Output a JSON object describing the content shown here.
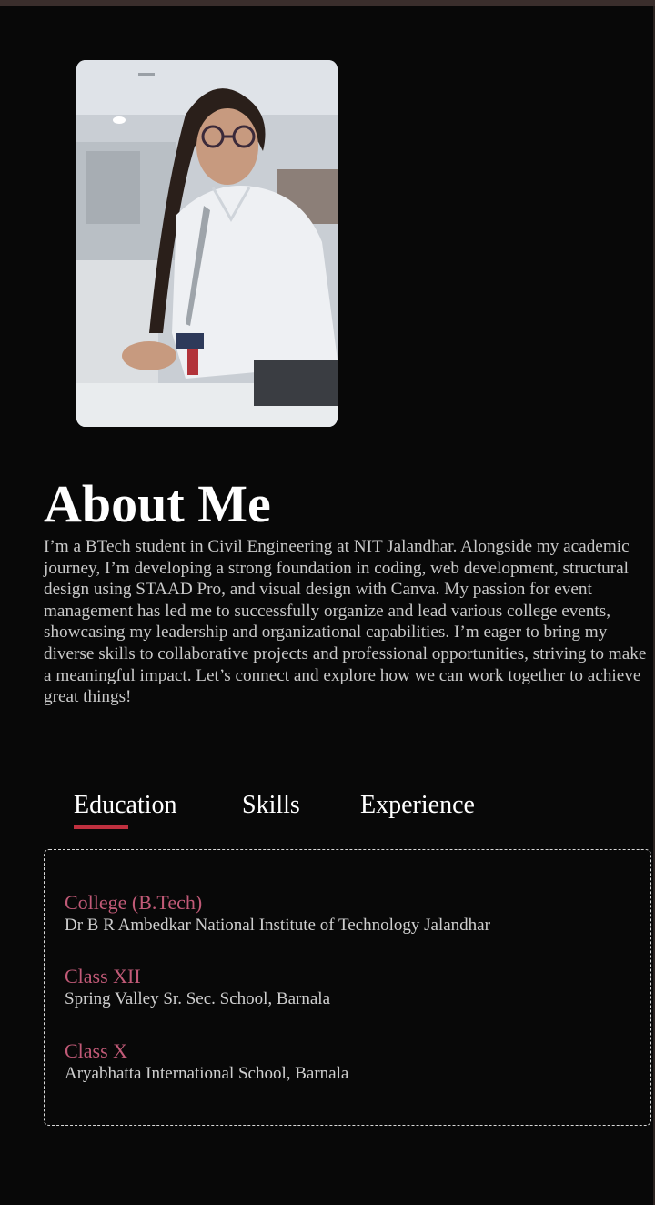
{
  "profile": {
    "photo_alt": "profile-photo"
  },
  "about": {
    "title": "About Me",
    "text": "I’m a BTech student in Civil Engineering at NIT Jalandhar. Alongside my academic journey, I’m developing a strong foundation in coding, web development, structural design using STAAD Pro, and visual design with Canva. My passion for event management has led me to successfully organize and lead various college events, showcasing my leadership and organizational capabilities. I’m eager to bring my diverse skills to collaborative projects and professional opportunities, striving to make a meaningful impact. Let’s connect and explore how we can work together to achieve great things!"
  },
  "tabs": [
    {
      "label": "Education",
      "active": true
    },
    {
      "label": "Skills",
      "active": false
    },
    {
      "label": "Experience",
      "active": false
    }
  ],
  "education": [
    {
      "heading": "College (B.Tech)",
      "detail": "Dr B R Ambedkar National Institute of Technology Jalandhar"
    },
    {
      "heading": "Class XII",
      "detail": "Spring Valley Sr. Sec. School, Barnala"
    },
    {
      "heading": "Class X",
      "detail": "Aryabhatta International School, Barnala"
    }
  ],
  "colors": {
    "background": "#080808",
    "accent_underline": "#c0303f",
    "education_heading": "#c15a77",
    "body_text": "#c9c9c9"
  }
}
